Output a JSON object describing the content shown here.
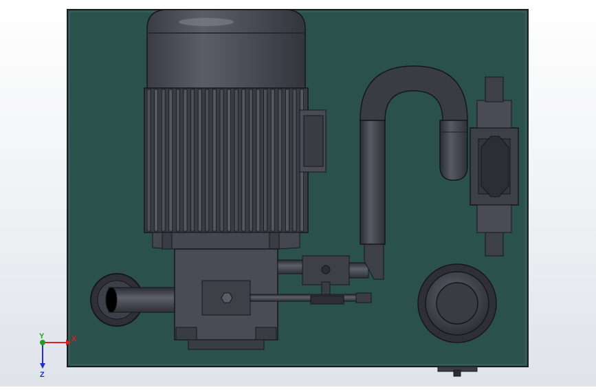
{
  "viewport": {
    "background_top": "#ffffff",
    "background_bottom": "#dfe3ea"
  },
  "model": {
    "name": "hydraulic-power-unit",
    "tank_color": "#2a514b",
    "metal_color": "#4a4c55",
    "metal_dark": "#2c2e34",
    "metal_light": "#6c6f79",
    "components": [
      "electric-motor",
      "pump-housing",
      "u-pipe",
      "directional-valve",
      "filler-cap",
      "suction-line"
    ]
  },
  "triad": {
    "x_label": "X",
    "y_label": "Y",
    "z_label": "Z",
    "x_color": "#e02020",
    "y_color": "#1fa01f",
    "z_color": "#2030c8"
  }
}
